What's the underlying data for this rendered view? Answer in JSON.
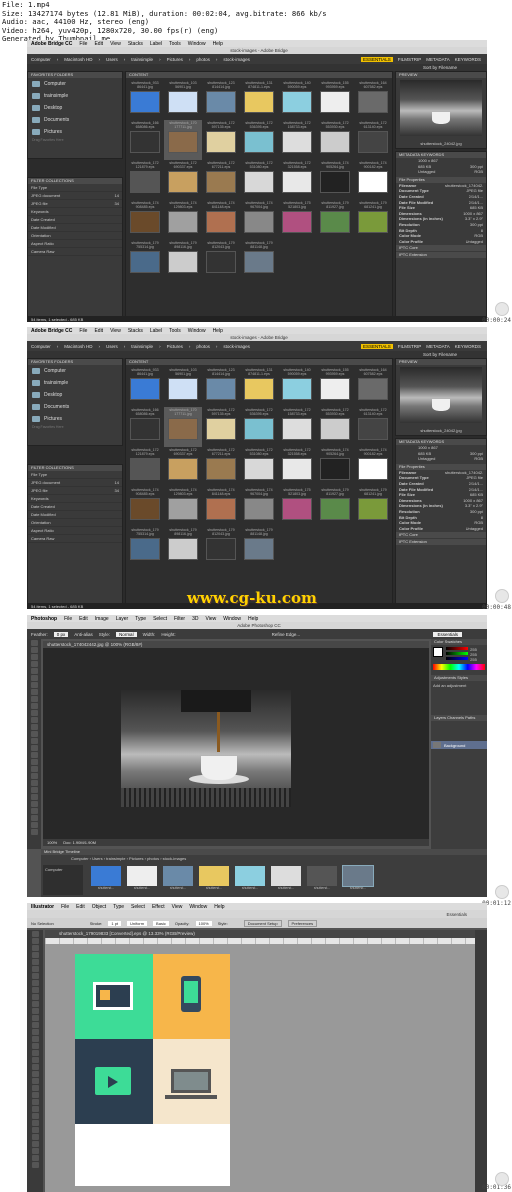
{
  "file_info": [
    "File: 1.mp4",
    "Size: 13427174 bytes (12.81 MiB), duration: 00:02:04, avg.bitrate: 866 kb/s",
    "Audio: aac, 44100 Hz, stereo (eng)",
    "Video: h264, yuv420p, 1280x720, 30.00 fps(r) (eng)",
    "Generated by Thumbnail me"
  ],
  "timestamps": [
    "00:00:24",
    "00:00:48",
    "00:01:12",
    "00:01:36"
  ],
  "bridge": {
    "menubar": [
      "Adobe Bridge CC",
      "File",
      "Edit",
      "View",
      "Stacks",
      "Label",
      "Tools",
      "Window",
      "Help"
    ],
    "window_title": "stock-images - Adobe Bridge",
    "breadcrumb": [
      "Computer",
      "Macintosh HD",
      "Users",
      "trainsimple",
      "Pictures",
      "photos",
      "stock-images"
    ],
    "workspaces": [
      "ESSENTIALS",
      "FILMSTRIP",
      "METADATA",
      "KEYWORDS"
    ],
    "sort_label": "Sort by Filename",
    "panel_tabs": {
      "left": "FAVORITES  FOLDERS",
      "content": "CONTENT",
      "preview": "PREVIEW",
      "filter": "FILTER  COLLECTIONS",
      "metadata": "METADATA  KEYWORDS"
    },
    "favorites": [
      "Computer",
      "trainsimple",
      "Desktop",
      "Documents",
      "Pictures"
    ],
    "drag_hint": "Drag Favorites Here",
    "filters": [
      [
        "File Type",
        ""
      ],
      [
        "JPEG document",
        "14"
      ],
      [
        "JPEG file",
        "34"
      ],
      [
        "Keywords",
        ""
      ],
      [
        "Date Created",
        ""
      ],
      [
        "Date Modified",
        ""
      ],
      [
        "Orientation",
        ""
      ],
      [
        "Aspect Ratio",
        ""
      ],
      [
        "Camera Raw",
        ""
      ]
    ],
    "thumbs": [
      [
        "shutterstock_933",
        "86441.jpg"
      ],
      [
        "shutterstock_103",
        "56901.jpg"
      ],
      [
        "shutterstock_123",
        "814414.jpg"
      ],
      [
        "shutterstock_131",
        "874811-1.eps"
      ],
      [
        "shutterstock_140",
        "590059.eps"
      ],
      [
        "shutterstock_155",
        "993959.eps"
      ],
      [
        "shutterstock_164",
        "607582.eps"
      ],
      [
        "shutterstock_166",
        "658086.eps"
      ],
      [
        "shutterstock_170",
        "177711.jpg"
      ],
      [
        "shutterstock_172",
        "597135.eps"
      ],
      [
        "shutterstock_172",
        "536395.eps"
      ],
      [
        "shutterstock_172",
        "158733.eps"
      ],
      [
        "shutterstock_172",
        "553930.eps"
      ],
      [
        "shutterstock_172",
        "613140.eps"
      ],
      [
        "shutterstock_172",
        "121879.eps"
      ],
      [
        "shutterstock_172",
        "690337.eps"
      ],
      [
        "shutterstock_172",
        "677211.eps"
      ],
      [
        "shutterstock_172",
        "531080.eps"
      ],
      [
        "shutterstock_172",
        "321558.eps"
      ],
      [
        "shutterstock_174",
        "905264.jpg"
      ],
      [
        "shutterstock_174",
        "900182.eps"
      ],
      [
        "shutterstock_174",
        "908485.eps"
      ],
      [
        "shutterstock_174",
        "129803.eps"
      ],
      [
        "shutterstock_174",
        "841148.eps"
      ],
      [
        "shutterstock_174",
        "967004.jpg"
      ],
      [
        "shutterstock_175",
        "521803.jpg"
      ],
      [
        "shutterstock_179",
        "811927.jpg"
      ],
      [
        "shutterstock_179",
        "681241.jpg"
      ],
      [
        "shutterstock_179",
        "755314.jpg"
      ],
      [
        "shutterstock_179",
        "898116.jpg"
      ],
      [
        "shutterstock_179",
        "812043.jpg"
      ],
      [
        "shutterstock_179",
        "881148.jpg"
      ]
    ],
    "preview_name": "shutterstock_24042.jpg",
    "meta_summary": [
      [
        "1000 x 867",
        ""
      ],
      [
        "685 KB",
        "300 ppi"
      ],
      [
        "Untagged",
        "RGB"
      ]
    ],
    "file_properties": [
      [
        "Filename",
        "shutterstock_174042.jpg"
      ],
      [
        "Document Type",
        "JPEG file"
      ],
      [
        "Date Created",
        "2/14/1..."
      ],
      [
        "Date File Modified",
        "2/14/1..."
      ],
      [
        "File Size",
        "685 KB"
      ],
      [
        "Dimensions",
        "1000 x 867"
      ],
      [
        "Dimensions (in inches)",
        "3.3\" x 2.9\""
      ],
      [
        "Resolution",
        "300 ppi"
      ],
      [
        "Bit Depth",
        "8"
      ],
      [
        "Color Mode",
        "RGB"
      ],
      [
        "Color Profile",
        "Untagged"
      ]
    ],
    "sections": [
      "IPTC Core",
      "IPTC Extension"
    ],
    "status": "54 items, 1 selected - 685 KB",
    "watermark": "www.cg-ku.com"
  },
  "photoshop": {
    "menubar": [
      "Photoshop",
      "File",
      "Edit",
      "Image",
      "Layer",
      "Type",
      "Select",
      "Filter",
      "3D",
      "View",
      "Window",
      "Help"
    ],
    "window_title": "Adobe Photoshop CC",
    "doc_tab": "shutterstock_174042442.jpg @ 100% (RGB/8#)",
    "options": [
      "Feather:",
      "0 px",
      "Anti-alias",
      "Style:",
      "Normal",
      "Width:",
      "Height:",
      "Refine Edge..."
    ],
    "essentials": "Essentials",
    "color_tabs": "Color  Swatches",
    "rgb": [
      "255",
      "255",
      "255"
    ],
    "adjust_tabs": "Adjustments  Styles",
    "adjust_hint": "Add an adjustment",
    "layers_tabs": "Layers  Channels  Paths",
    "layer_name": "Background",
    "zoom": "100%",
    "doc_size": "Doc: 1.90M/1.90M",
    "mini_tabs": "Mini Bridge  Timeline",
    "mini_path": [
      "Computer",
      "Users",
      "trainsimple",
      "Pictures",
      "photos",
      "stock-images"
    ],
    "mini_side": "Computer",
    "mini_labels": [
      "shutterst...",
      "shutterst...",
      "shutterst...",
      "shutterst...",
      "shutterst...",
      "shutterst...",
      "shutterst...",
      "shutterst..."
    ]
  },
  "illustrator": {
    "menubar": [
      "Illustrator",
      "File",
      "Edit",
      "Object",
      "Type",
      "Select",
      "Effect",
      "View",
      "Window",
      "Help"
    ],
    "essentials": "Essentials",
    "control": [
      "No Selection",
      "Stroke:",
      "1 pt",
      "Uniform",
      "Basic",
      "Opacity:",
      "100%",
      "Style:",
      "Document Setup",
      "Preferences"
    ],
    "doc_tab": "shutterstock_179019833 [Converted].eps @ 13.33% (RGB/Preview)",
    "tiles": [
      "#3ddc97",
      "#f7b64a",
      "#2c3e50",
      "#f5e6cc"
    ]
  },
  "colors": {
    "bridge_bg": "#2b2b2b",
    "accent": "#f0c000",
    "ps_bg": "#535353",
    "ai_bg": "#535353"
  }
}
